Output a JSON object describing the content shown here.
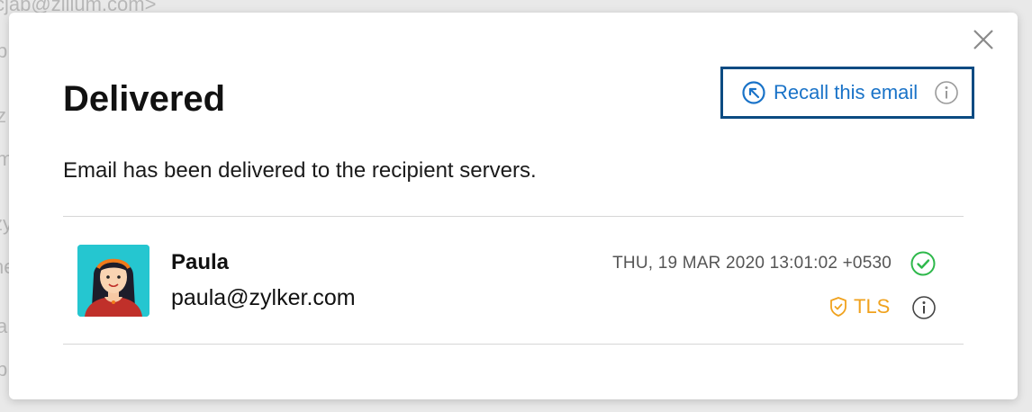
{
  "background": {
    "lines": [
      "cjab@zillum.com>",
      "p",
      "z",
      "m",
      "zy",
      "ne",
      "a",
      "b"
    ]
  },
  "dialog": {
    "title": "Delivered",
    "subtitle": "Email has been delivered to the recipient servers.",
    "recall": {
      "label": "Recall this email"
    },
    "close_icon": "close-icon"
  },
  "recipient": {
    "name": "Paula",
    "email": "paula@zylker.com",
    "timestamp": "THU, 19 MAR 2020 13:01:02 +0530",
    "status": "delivered",
    "security": "TLS"
  },
  "colors": {
    "accent_blue": "#1a73c8",
    "recall_border": "#0b4b82",
    "success_green": "#2eb84b",
    "tls_orange": "#f0a21e"
  }
}
